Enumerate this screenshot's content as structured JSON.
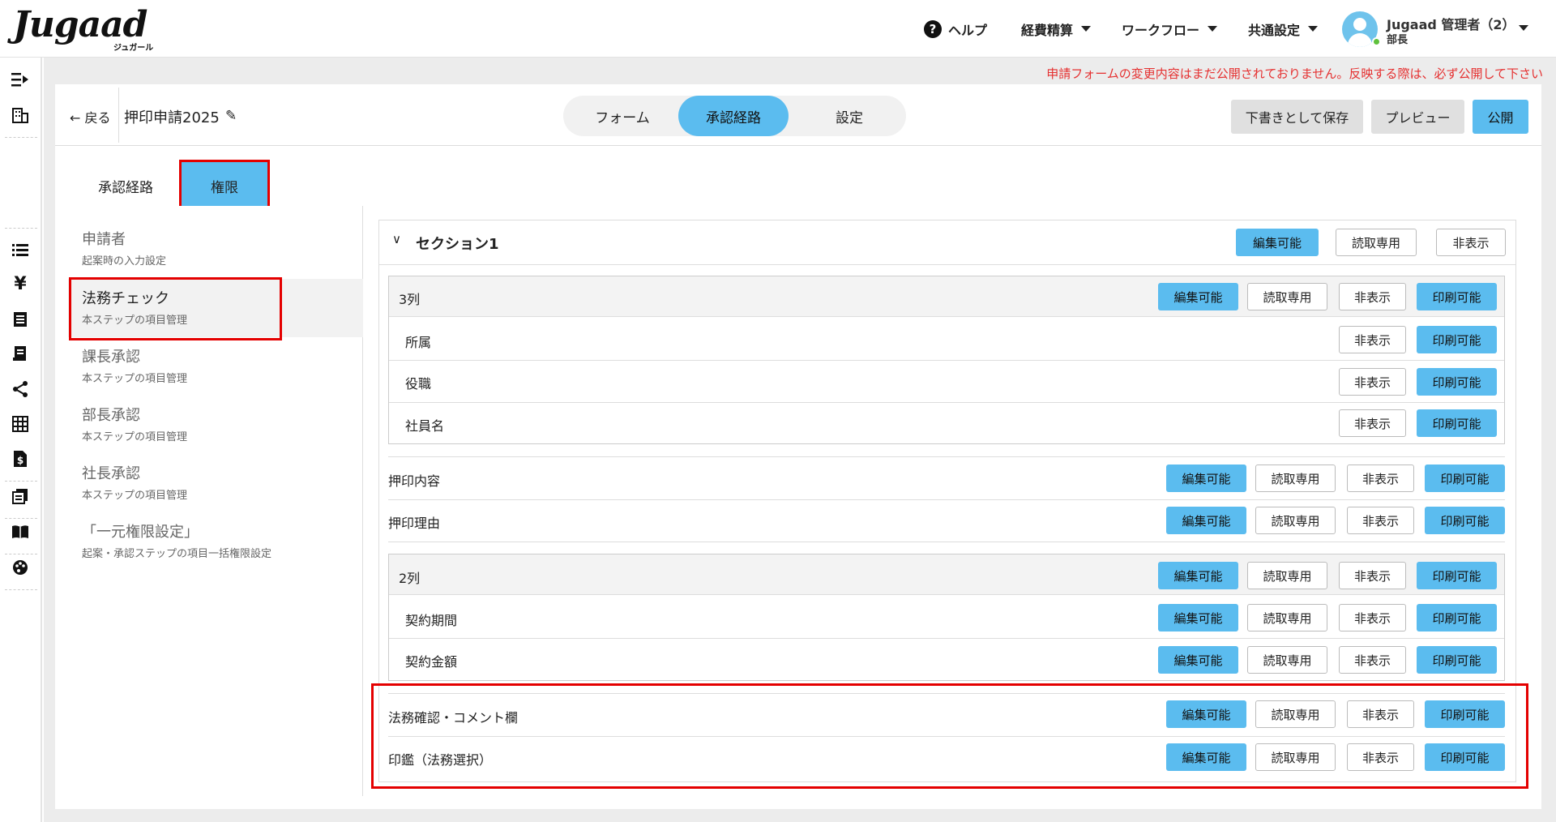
{
  "header": {
    "logo": "Jugaad",
    "logo_sub": "ジュガール",
    "help": "ヘルプ",
    "menu_expense": "経費精算",
    "menu_workflow": "ワークフロー",
    "menu_common": "共通設定",
    "user_name": "Jugaad 管理者（2）",
    "user_role": "部長"
  },
  "notice": "申請フォームの変更内容はまだ公開されておりません。反映する際は、必ず公開して下さい",
  "form": {
    "back": "戻る",
    "title": "押印申請2025",
    "tabs": [
      "フォーム",
      "承認経路",
      "設定"
    ],
    "active_tab": "承認経路",
    "save_draft": "下書きとして保存",
    "preview": "プレビュー",
    "publish": "公開"
  },
  "subtabs": [
    "承認経路",
    "権限"
  ],
  "steps": [
    {
      "title": "申請者",
      "sub": "起案時の入力設定"
    },
    {
      "title": "法務チェック",
      "sub": "本ステップの項目管理"
    },
    {
      "title": "課長承認",
      "sub": "本ステップの項目管理"
    },
    {
      "title": "部長承認",
      "sub": "本ステップの項目管理"
    },
    {
      "title": "社長承認",
      "sub": "本ステップの項目管理"
    },
    {
      "title": "「一元権限設定」",
      "sub": "起案・承認ステップの項目一括権限設定"
    }
  ],
  "perm_labels": {
    "edit": "編集可能",
    "read": "読取専用",
    "hide": "非表示",
    "print": "印刷可能"
  },
  "section": {
    "title": "セクション1",
    "group1": {
      "title": "3列",
      "fields": [
        "所属",
        "役職",
        "社員名"
      ]
    },
    "field_a": "押印内容",
    "field_b": "押印理由",
    "group2": {
      "title": "2列",
      "fields": [
        "契約期間",
        "契約金額"
      ]
    },
    "field_c": "法務確認・コメント欄",
    "field_d": "印鑑（法務選択）"
  }
}
